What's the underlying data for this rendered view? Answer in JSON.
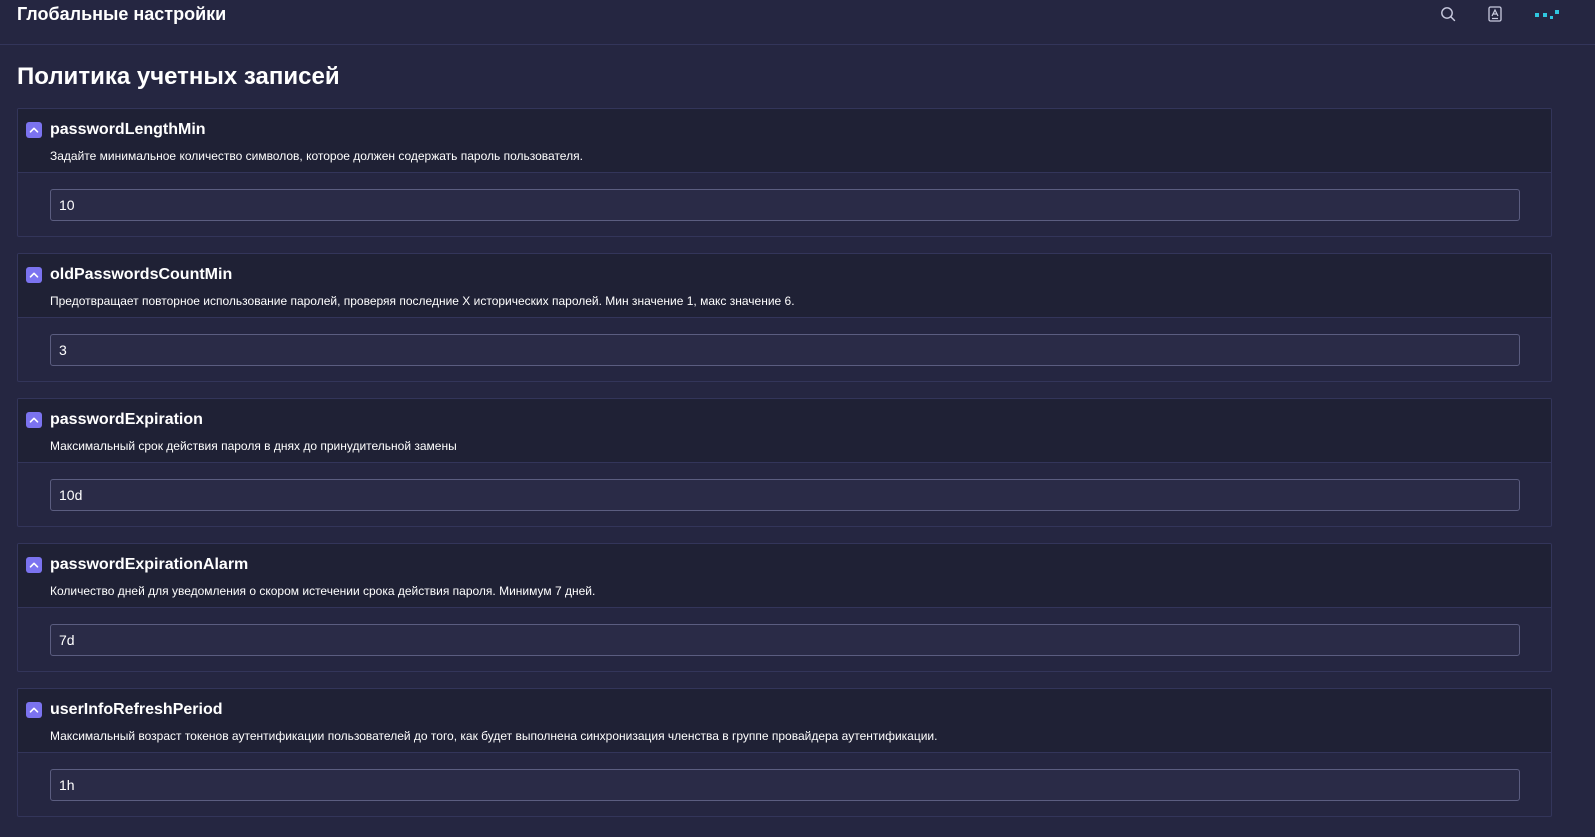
{
  "header": {
    "title": "Глобальные настройки",
    "icons": [
      "search-icon",
      "document-icon",
      "app-logo-icon"
    ]
  },
  "page": {
    "title": "Политика учетных записей"
  },
  "settings": [
    {
      "name": "passwordLengthMin",
      "description": "Задайте минимальное количество символов, которое должен содержать пароль пользователя.",
      "value": "10"
    },
    {
      "name": "oldPasswordsCountMin",
      "description": "Предотвращает повторное использование паролей, проверяя последние X исторических паролей. Мин значение 1, макс значение 6.",
      "value": "3"
    },
    {
      "name": "passwordExpiration",
      "description": "Максимальный срок действия пароля в днях до принудительной замены",
      "value": "10d"
    },
    {
      "name": "passwordExpirationAlarm",
      "description": "Количество дней для уведомления о скором истечении срока действия пароля. Минимум 7 дней.",
      "value": "7d"
    },
    {
      "name": "userInfoRefreshPeriod",
      "description": "Максимальный возраст токенов аутентификации пользователей до того, как будет выполнена синхронизация членства в группе провайдера аутентификации.",
      "value": "1h"
    }
  ],
  "colors": {
    "background": "#252641",
    "card_header": "#1f2135",
    "accent": "#7b73f0",
    "logo": "#2fc7e0"
  }
}
